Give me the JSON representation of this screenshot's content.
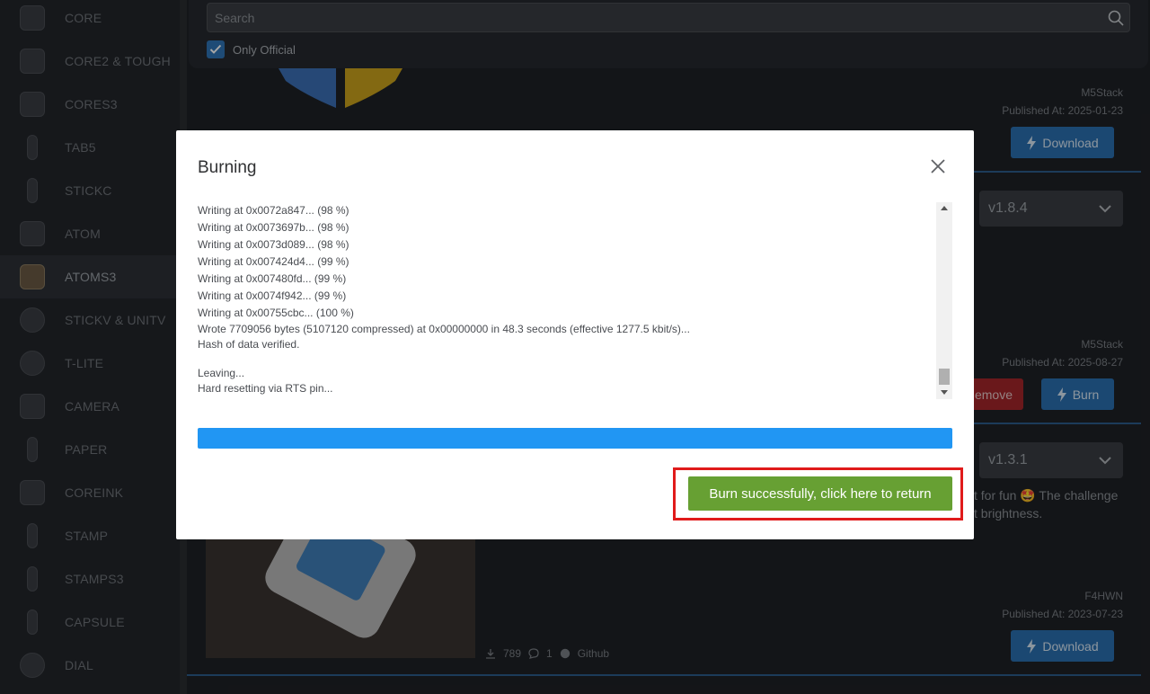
{
  "sidebar": {
    "items": [
      {
        "label": "CORE",
        "icon": "core-device-icon"
      },
      {
        "label": "CORE2 & TOUGH",
        "icon": "core2-device-icon"
      },
      {
        "label": "CORES3",
        "icon": "cores3-device-icon"
      },
      {
        "label": "TAB5",
        "icon": "tab5-device-icon"
      },
      {
        "label": "STICKC",
        "icon": "stickc-device-icon"
      },
      {
        "label": "ATOM",
        "icon": "atom-device-icon"
      },
      {
        "label": "ATOMS3",
        "icon": "atoms3-device-icon",
        "active": true
      },
      {
        "label": "STICKV & UNITV",
        "icon": "stickv-device-icon"
      },
      {
        "label": "T-LITE",
        "icon": "tlite-device-icon"
      },
      {
        "label": "CAMERA",
        "icon": "camera-device-icon"
      },
      {
        "label": "PAPER",
        "icon": "paper-device-icon"
      },
      {
        "label": "COREINK",
        "icon": "coreink-device-icon"
      },
      {
        "label": "STAMP",
        "icon": "stamp-device-icon"
      },
      {
        "label": "STAMPS3",
        "icon": "stamps3-device-icon"
      },
      {
        "label": "CAPSULE",
        "icon": "capsule-device-icon"
      },
      {
        "label": "DIAL",
        "icon": "dial-device-icon"
      }
    ]
  },
  "search": {
    "placeholder": "Search",
    "value": "",
    "only_official_label": "Only Official",
    "only_official_checked": true
  },
  "cards": [
    {
      "author": "M5Stack",
      "published": "Published At: 2025-01-23",
      "action": "Download"
    },
    {
      "author": "M5Stack",
      "published": "Published At: 2025-08-27",
      "version": "v1.8.4",
      "remove_label": "emove",
      "action": "Burn"
    },
    {
      "author": "F4HWN",
      "published": "Published At: 2023-07-23",
      "version": "v1.3.1",
      "desc_line1": "t for fun 🤩 The challenge",
      "desc_line2": "t brightness.",
      "downloads": "789",
      "comments": "1",
      "github": "Github",
      "action": "Download"
    }
  ],
  "modal": {
    "title": "Burning",
    "log_lines": [
      "Writing at 0x0072a847... (98 %)",
      "Writing at 0x0073697b... (98 %)",
      "Writing at 0x0073d089... (98 %)",
      "Writing at 0x007424d4... (99 %)",
      "Writing at 0x007480fd... (99 %)",
      "Writing at 0x0074f942... (99 %)",
      "Writing at 0x00755cbc... (100 %)",
      "Wrote 7709056 bytes (5107120 compressed) at 0x00000000 in 48.3 seconds (effective 1277.5 kbit/s)...",
      "Hash of data verified.",
      "",
      "Leaving...",
      "Hard resetting via RTS pin..."
    ],
    "progress": 1.0,
    "success_button": "Burn successfully, click here to return"
  },
  "colors": {
    "progress": "#2196f3",
    "success": "#67a033",
    "highlight": "#e01b1b",
    "primary": "#2a6fb0"
  }
}
